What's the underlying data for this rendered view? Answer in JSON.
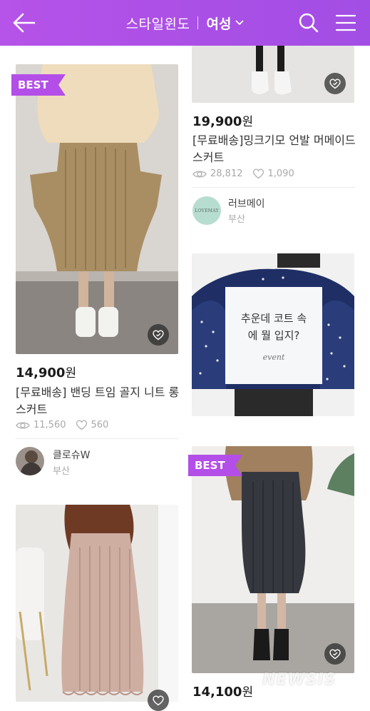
{
  "header": {
    "title": "스타일윈도",
    "gender": "여성",
    "background": "#aa50e6"
  },
  "products": [
    {
      "badge": "BEST",
      "price_value": "14,900",
      "price_unit": "원",
      "name": "[무료배송] 밴딩 트임 골지 니트 롱스커트",
      "views": "11,560",
      "likes": "560",
      "seller": {
        "name": "클로슈W",
        "location": "부산"
      }
    },
    {
      "badge": "",
      "price_value": "19,900",
      "price_unit": "원",
      "name": "[무료배송]밍크기모 언발 머메이드스커트",
      "views": "28,812",
      "likes": "1,090",
      "seller": {
        "name": "러브메이",
        "location": "부산",
        "logo_text": "LOVEMAY"
      }
    },
    {
      "badge": "BEST",
      "price_value": "14,100",
      "price_unit": "원"
    }
  ],
  "event": {
    "text": "추운데 코트 속\n에 뭘 입지?",
    "label": "event"
  },
  "watermark": "NEWSIS",
  "colors": {
    "accent": "#b44ee8",
    "muted": "#a8a8a8"
  }
}
